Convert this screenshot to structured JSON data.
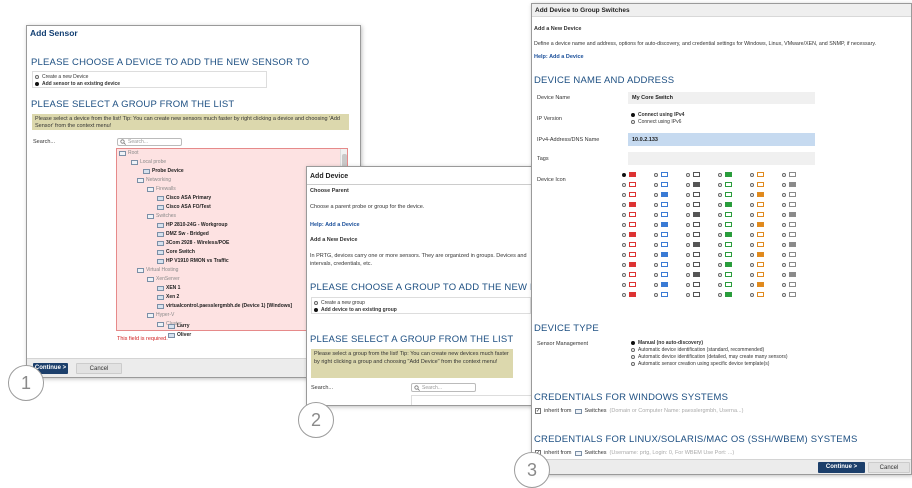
{
  "w1": {
    "title": "Add Sensor",
    "h1": "PLEASE CHOOSE A DEVICE TO ADD THE NEW SENSOR TO",
    "r1": "Create a new Device",
    "r2": "Add sensor to an existing device",
    "h2": "PLEASE SELECT A GROUP FROM THE LIST",
    "hint": "Please select a device from the list! Tip: You can create new sensors much faster by right clicking a device and choosing 'Add Sensor' from the context menu!",
    "search_label": "Search...",
    "search_placeholder": "Search...",
    "tree": [
      "Root",
      "Local probe",
      "Probe Device",
      "Networking",
      "Firewalls",
      "Cisco ASA Primary",
      "Cisco ASA FO/Test",
      "Switches",
      "HP 2810-24G - Workgroup",
      "DMZ Sw - Bridged",
      "3Com 2928 - Wireless/POE",
      "Core Switch",
      "HP V1910 RMON vs Traffic",
      "Virtual Hosting",
      "XenServer",
      "XEN 1",
      "Xen 2",
      "virtualcontrol.paesslergmbh.de (Device 1) [Windows]",
      "Hyper-V",
      "Cluster",
      "Larry",
      "Oliver"
    ],
    "required": "This field is required.",
    "continue": "Continue >",
    "cancel": "Cancel"
  },
  "w2": {
    "title": "Add Device",
    "choose_parent": "Choose Parent",
    "choose_parent_desc": "Choose a parent probe or group for the device.",
    "help": "Help: Add a Device",
    "add_new": "Add a New Device",
    "add_new_desc": "In PRTG, devices carry one or more sensors. They are organized in groups. Devices and intervals, credentials, etc.",
    "h1": "PLEASE CHOOSE A GROUP TO ADD THE NEW DEVICE T",
    "r1": "Create a new group",
    "r2": "Add device to an existing group",
    "h2": "PLEASE SELECT A GROUP FROM THE LIST",
    "hint": "Please select a group from the list! Tip: You can create new devices much faster by right clicking a group and choosing \"Add Device\" from the context menu!",
    "search_label": "Search...",
    "search_placeholder": "Search..."
  },
  "w3": {
    "title": "Add Device to Group Switches",
    "sub": "Add a New Device",
    "desc": "Define a device name and address, options for auto-discovery, and credential settings for Windows, Linux, VMware/XEN, and SNMP, if necessary.",
    "help": "Help: Add a Device",
    "h_name": "DEVICE NAME AND ADDRESS",
    "device_name_label": "Device Name",
    "device_name": "My Core Switch",
    "ip_label": "IP Version",
    "ip4": "Connect using IPv4",
    "ip6": "Connect using IPv6",
    "addr_label": "IPv4-Address/DNS Name",
    "addr": "10.0.2.133",
    "tags_label": "Tags",
    "icon_label": "Device Icon",
    "h_type": "DEVICE TYPE",
    "sm_label": "Sensor Management",
    "sm": [
      "Manual (no auto-discovery)",
      "Automatic device identification (standard, recommended)",
      "Automatic device identification (detailed, may create many sensors)",
      "Automatic sensor creation using specific device template(s)"
    ],
    "h_win": "CREDENTIALS FOR WINDOWS SYSTEMS",
    "win_inherit": "inherit from",
    "win_group": "Switches",
    "win_note": "(Domain or Computer Name: paesslergmbh, Userna...)",
    "h_linux": "CREDENTIALS FOR LINUX/SOLARIS/MAC OS (SSH/WBEM) SYSTEMS",
    "linux_inherit": "inherit from",
    "linux_group": "Switches",
    "linux_note": "(Username: prtg, Login: 0, For WBEM Use Port: ...)",
    "continue": "Continue >",
    "cancel": "Cancel"
  },
  "steps": [
    "1",
    "2",
    "3"
  ]
}
